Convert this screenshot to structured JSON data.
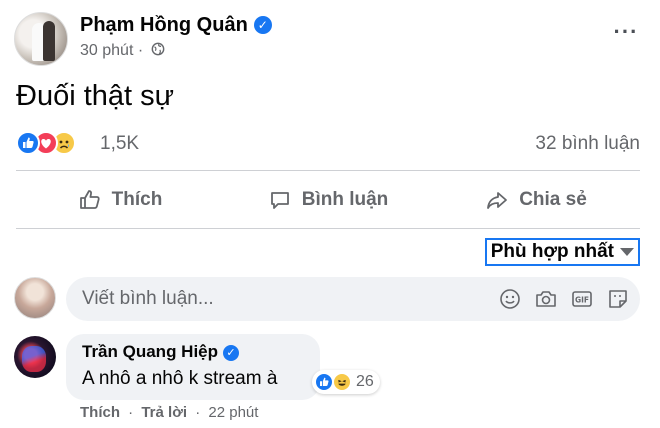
{
  "post": {
    "author": "Phạm Hồng Quân",
    "time": "30 phút",
    "separator": "·",
    "text": "Đuối thật sự",
    "reaction_count": "1,5K",
    "comment_count": "32 bình luận",
    "reactions": [
      "like-icon",
      "love-icon",
      "sad-icon"
    ]
  },
  "actions": {
    "like": "Thích",
    "comment": "Bình luận",
    "share": "Chia sẻ"
  },
  "sort": {
    "selected": "Phù hợp nhất"
  },
  "composer": {
    "placeholder": "Viết bình luận...",
    "icons": [
      "emoji-icon",
      "camera-icon",
      "gif-icon",
      "sticker-icon"
    ]
  },
  "comment": {
    "author": "Trần Quang Hiệp",
    "text": "A nhô a nhô k stream à",
    "reaction_count": "26",
    "reactions": [
      "like-icon",
      "haha-icon"
    ],
    "like_label": "Thích",
    "reply_label": "Trả lời",
    "separator": "·",
    "time": "22 phút"
  },
  "colors": {
    "brand_blue": "#1877f2",
    "secondary_text": "#65676b",
    "bubble_bg": "#f0f2f5",
    "love_red": "#f33e58",
    "sad_yellow": "#f7c948"
  }
}
